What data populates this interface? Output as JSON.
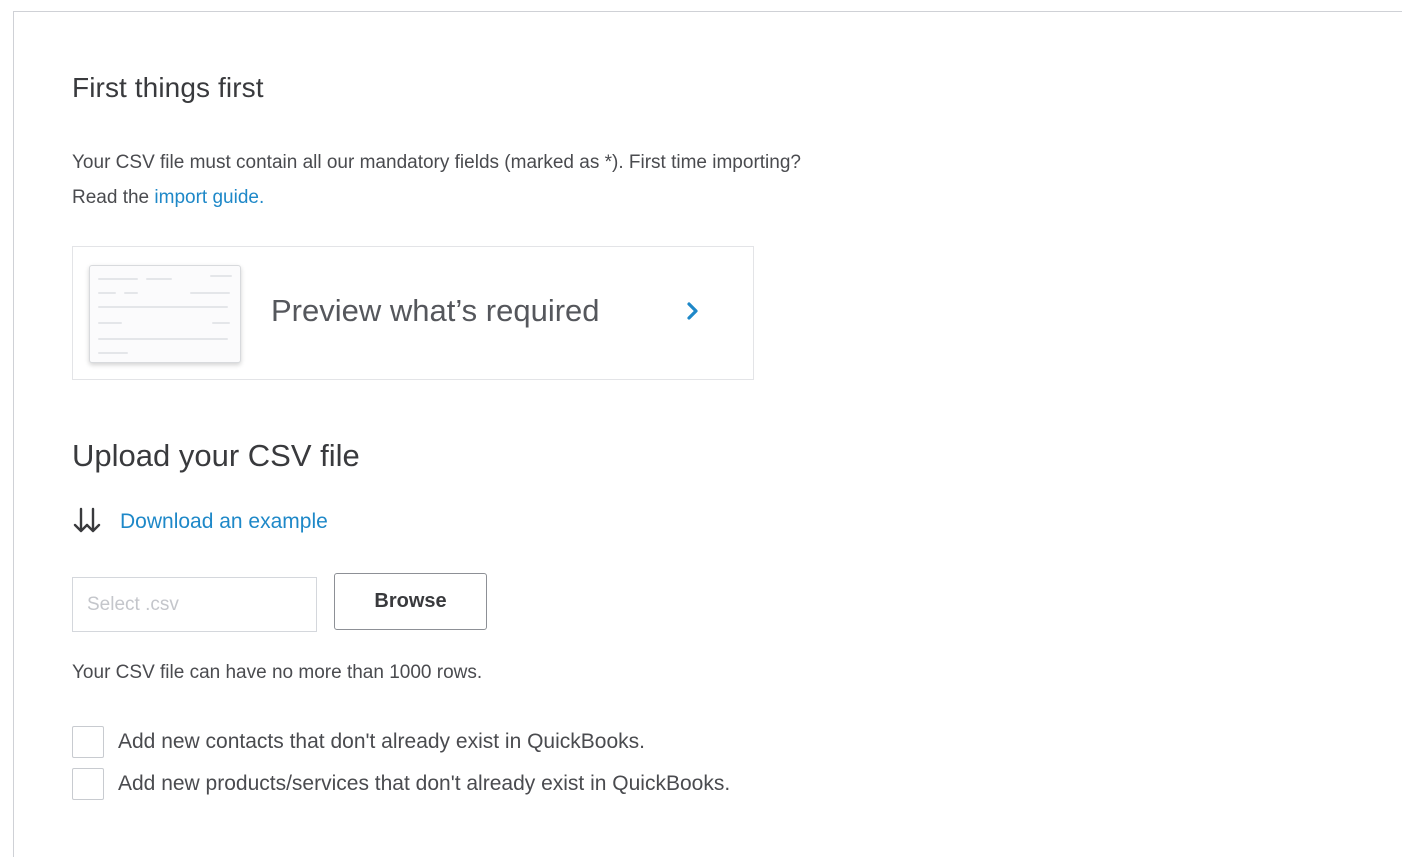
{
  "first_section": {
    "heading": "First things first",
    "intro_line1": "Your CSV file must contain all our mandatory fields (marked as *). First time importing?",
    "intro_line2_prefix": "Read the ",
    "import_guide_link": "import guide.",
    "preview_card_label": "Preview what’s required",
    "preview_chevron_icon": "chevron-right-icon"
  },
  "upload_section": {
    "heading": "Upload your CSV file",
    "download_icon": "download-arrows-icon",
    "download_link": "Download an example",
    "file_input_placeholder": "Select .csv",
    "file_input_value": "",
    "browse_label": "Browse",
    "row_limit_note": "Your CSV file can have no more than 1000 rows.",
    "options": [
      {
        "label": "Add new contacts that don't already exist in QuickBooks.",
        "checked": false
      },
      {
        "label": "Add new products/services that don't already exist in QuickBooks.",
        "checked": false
      }
    ]
  },
  "colors": {
    "link": "#1e88c8",
    "text": "#393a3d",
    "border": "#d4d7dc"
  }
}
